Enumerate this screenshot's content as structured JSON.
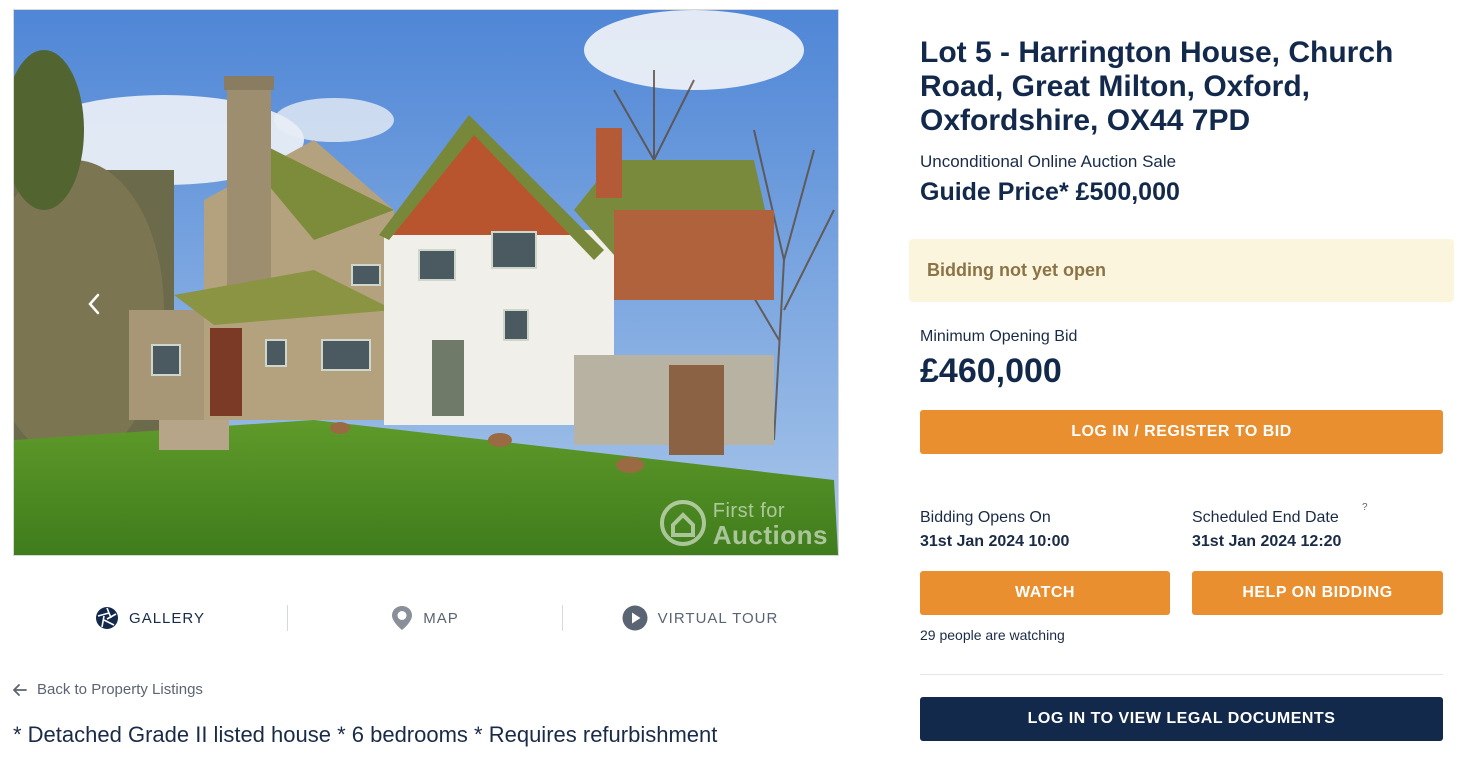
{
  "gallery": {
    "watermark_line1": "First for",
    "watermark_line2": "Auctions"
  },
  "media_tabs": [
    {
      "label": "GALLERY",
      "icon": "aperture-icon"
    },
    {
      "label": "MAP",
      "icon": "map-pin-icon"
    },
    {
      "label": "VIRTUAL TOUR",
      "icon": "play-icon"
    }
  ],
  "back_link": "Back to Property Listings",
  "summary": "* Detached Grade II listed house * 6 bedrooms * Requires refurbishment",
  "lot": {
    "title": "Lot 5 - Harrington House, Church Road, Great Milton, Oxford, Oxfordshire, OX44 7PD",
    "sale_type": "Unconditional Online Auction Sale",
    "guide_price": "Guide Price* £500,000"
  },
  "bidding": {
    "status": "Bidding not yet open",
    "min_label": "Minimum Opening Bid",
    "min_value": "£460,000",
    "register_button": "LOG IN / REGISTER TO BID",
    "opens_label": "Bidding Opens On",
    "opens_value": "31st Jan 2024 10:00",
    "end_label": "Scheduled End Date",
    "end_help": "?",
    "end_value": "31st Jan 2024 12:20",
    "watch_button": "WATCH",
    "help_button": "HELP ON BIDDING",
    "watchers": "29 people are watching",
    "legal_button": "LOG IN TO VIEW LEGAL DOCUMENTS"
  },
  "colors": {
    "navy": "#13294b",
    "orange": "#ea8f2f",
    "status_bg": "#fcf5de",
    "status_text": "#8b7346"
  }
}
